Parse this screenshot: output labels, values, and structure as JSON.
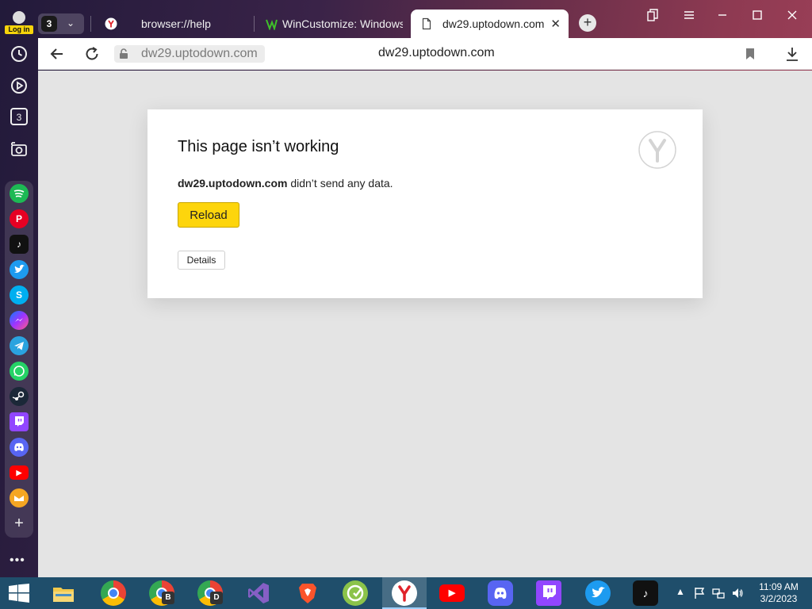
{
  "login": {
    "label": "Log in"
  },
  "tabgroup": {
    "count": "3"
  },
  "tabs": [
    {
      "title": "browser://help"
    },
    {
      "title": "WinCustomize: Windows t"
    },
    {
      "title": "dw29.uptodown.com"
    }
  ],
  "addressbar": {
    "url_domain": "dw29.uptodown.com",
    "page_title": "dw29.uptodown.com"
  },
  "sidebar": {
    "tabs_count": "3",
    "apps": [
      "Spotify",
      "Pinterest",
      "TikTok",
      "Twitter",
      "Skype",
      "Messenger",
      "Telegram",
      "WhatsApp",
      "Steam",
      "Twitch",
      "Discord",
      "YouTube",
      "Yandex Mail"
    ]
  },
  "error": {
    "heading": "This page isn’t working",
    "domain": "dw29.uptodown.com",
    "message": " didn’t send any data.",
    "reload_label": "Reload",
    "details_label": "Details"
  },
  "taskbar": {
    "time": "11:09 AM",
    "date": "3/2/2023",
    "browser_b_badge": "B",
    "browser_d_badge": "D"
  },
  "colors": {
    "accent_yellow": "#fdd50c",
    "taskbar": "#1f4e6b",
    "content_bg": "#e4e4e4"
  }
}
